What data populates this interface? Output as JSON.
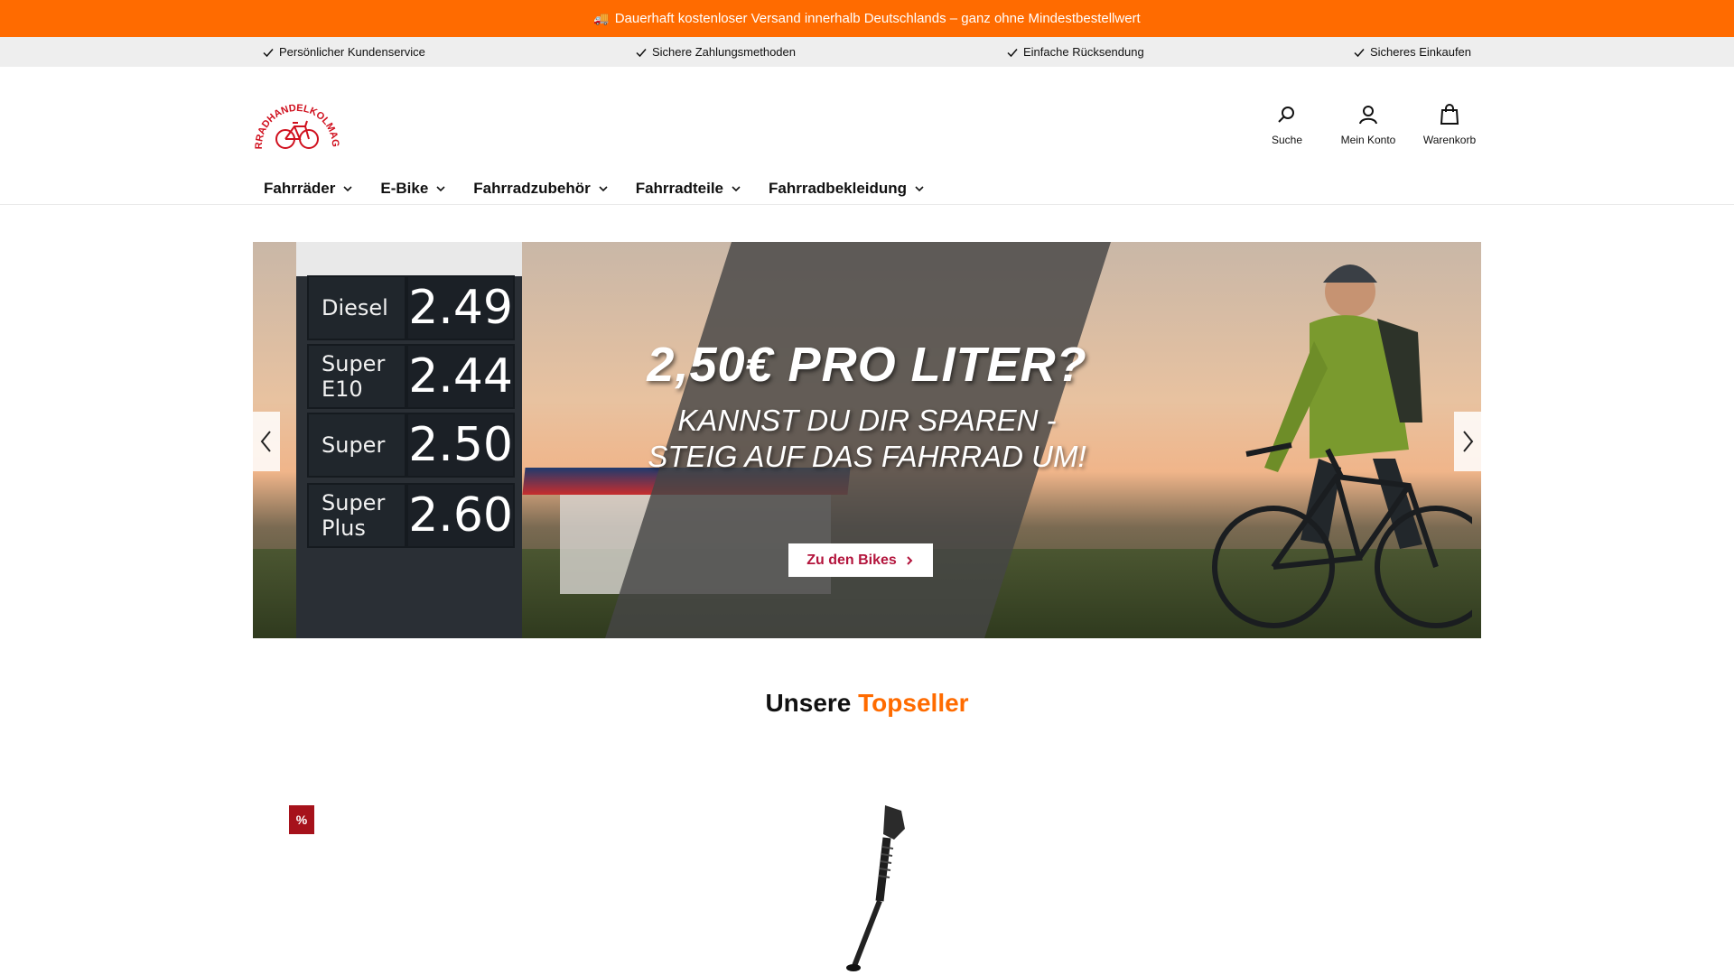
{
  "announcement": {
    "icon": "truck-icon",
    "text": "Dauerhaft kostenloser Versand innerhalb Deutschlands – ganz ohne Mindestbestellwert"
  },
  "usps": [
    {
      "icon": "check-icon",
      "text": "Persönlicher Kundenservice"
    },
    {
      "icon": "check-icon",
      "text": "Sichere Zahlungsmethoden"
    },
    {
      "icon": "check-icon",
      "text": "Einfache Rücksendung"
    },
    {
      "icon": "check-icon",
      "text": "Sicheres Einkaufen"
    }
  ],
  "logo": {
    "text": "FAHRRADHANDEL KOLMAGNON"
  },
  "header_actions": [
    {
      "icon": "search-icon",
      "label": "Suche"
    },
    {
      "icon": "user-icon",
      "label": "Mein Konto"
    },
    {
      "icon": "bag-icon",
      "label": "Warenkorb"
    }
  ],
  "nav": [
    {
      "label": "Fahrräder"
    },
    {
      "label": "E-Bike"
    },
    {
      "label": "Fahrradzubehör"
    },
    {
      "label": "Fahrradteile"
    },
    {
      "label": "Fahrradbekleidung"
    }
  ],
  "hero": {
    "title": "2,50€ PRO LITER?",
    "subtitle_line1": "KANNST DU DIR SPAREN -",
    "subtitle_line2": "STEIG AUF DAS FAHRRAD UM!",
    "button_label": "Zu den Bikes",
    "fuel_prices": [
      {
        "name": "Diesel",
        "price": "2.49"
      },
      {
        "name": "Super E10",
        "price": "2.44"
      },
      {
        "name": "Super",
        "price": "2.50"
      },
      {
        "name": "Super Plus",
        "price": "2.60"
      }
    ]
  },
  "section": {
    "title_plain": "Unsere",
    "title_accent": "Topseller"
  },
  "product": {
    "badge": "%"
  },
  "colors": {
    "accent": "#ff6b00",
    "brand_red": "#b3143c",
    "badge_red": "#a6121b"
  }
}
